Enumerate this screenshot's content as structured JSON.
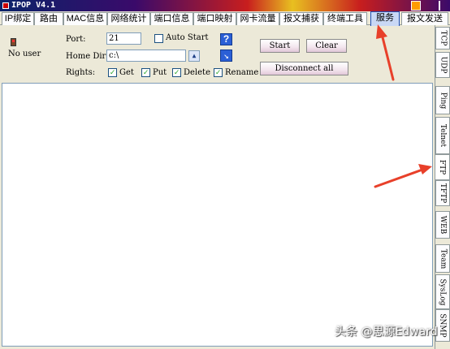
{
  "window": {
    "title": "IPOP V4.1"
  },
  "top_tabs": [
    {
      "label": "IP绑定"
    },
    {
      "label": "路由"
    },
    {
      "label": "MAC信息"
    },
    {
      "label": "网络统计"
    },
    {
      "label": "端口信息"
    },
    {
      "label": "端口映射"
    },
    {
      "label": "网卡流量"
    },
    {
      "label": "报文捕获"
    },
    {
      "label": "终端工具"
    },
    {
      "label": "服务",
      "active": true
    },
    {
      "label": "报文发送"
    }
  ],
  "side_tabs": [
    {
      "label": "TCP"
    },
    {
      "label": "UDP"
    },
    {
      "label": "Ping"
    },
    {
      "label": "Telnet"
    },
    {
      "label": "FTP",
      "active": true
    },
    {
      "label": "TFTP"
    },
    {
      "label": "WEB"
    },
    {
      "label": "Team"
    },
    {
      "label": "SysLog"
    },
    {
      "label": "SNMP"
    }
  ],
  "ftp": {
    "user_status": "No user",
    "port_label": "Port:",
    "port_value": "21",
    "auto_start_label": "Auto Start",
    "auto_start_checked": false,
    "home_dir_label": "Home Dir:",
    "home_dir_value": "c:\\",
    "rights_label": "Rights:",
    "rights": [
      {
        "label": "Get",
        "checked": true
      },
      {
        "label": "Put",
        "checked": true
      },
      {
        "label": "Delete",
        "checked": true
      },
      {
        "label": "Rename",
        "checked": true
      }
    ],
    "start_label": "Start",
    "clear_label": "Clear",
    "disconnect_label": "Disconnect all"
  },
  "watermark": "头条 @思源Edward",
  "icons": {
    "help": "help-icon",
    "nav": "arrow-icon",
    "browse": "folder-up-icon",
    "user": "user-icon"
  },
  "colors": {
    "active_tab": "#c9d8f5",
    "annotation_arrow": "#e8402a"
  }
}
